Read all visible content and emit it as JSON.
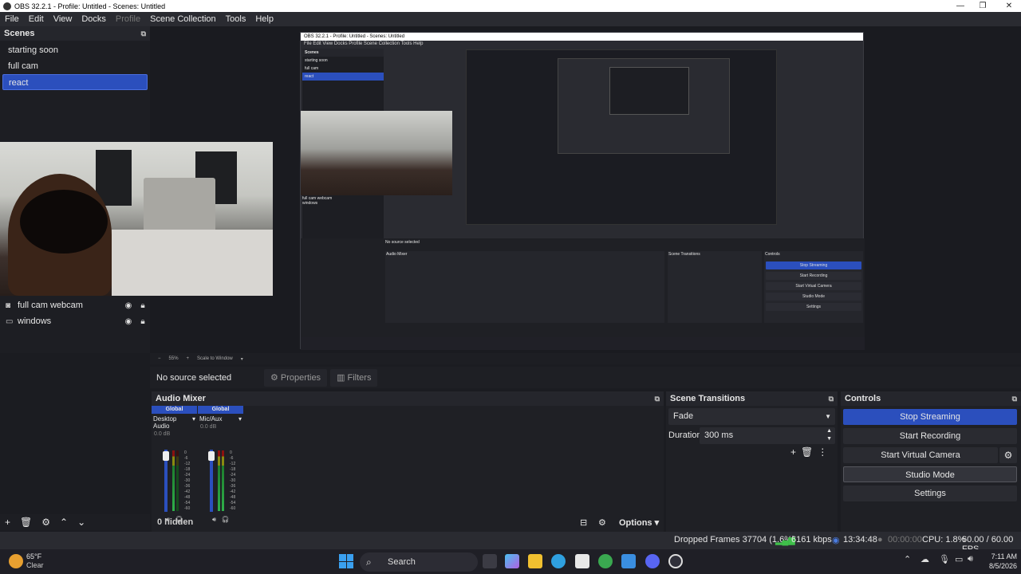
{
  "window": {
    "title": "OBS 32.2.1 - Profile: Untitled - Scenes: Untitled"
  },
  "menu": [
    "File",
    "Edit",
    "View",
    "Docks",
    "Profile",
    "Scene Collection",
    "Tools",
    "Help"
  ],
  "scenes": {
    "title": "Scenes",
    "items": [
      "starting soon",
      "full cam",
      "react"
    ],
    "active": "react"
  },
  "sources": {
    "items": [
      {
        "name": "full cam webcam",
        "icon": "camera-icon"
      },
      {
        "name": "windows",
        "icon": "monitor-icon"
      }
    ]
  },
  "preview": {
    "zoom": "55%",
    "scale_mode": "Scale to Window"
  },
  "context": {
    "no_source": "No source selected",
    "properties": "Properties",
    "filters": "Filters"
  },
  "audio_mixer": {
    "title": "Audio Mixer",
    "channels": [
      {
        "tag": "Global",
        "name": "Desktop Audio",
        "db": "0.0 dB"
      },
      {
        "tag": "Global",
        "name": "Mic/Aux",
        "db": "0.0 dB"
      }
    ],
    "scale": [
      "0",
      "-6",
      "-12",
      "-18",
      "-24",
      "-30",
      "-36",
      "-42",
      "-48",
      "-54",
      "-60"
    ],
    "hidden": "0 hidden",
    "options": "Options"
  },
  "transitions": {
    "title": "Scene Transitions",
    "selected": "Fade",
    "duration_label": "Duration",
    "duration": "300 ms"
  },
  "controls": {
    "title": "Controls",
    "stop_streaming": "Stop Streaming",
    "start_recording": "Start Recording",
    "start_virtual_camera": "Start Virtual Camera",
    "studio_mode": "Studio Mode",
    "settings": "Settings"
  },
  "status": {
    "dropped": "Dropped Frames 37704 (1.6%)",
    "bitrate": "6161 kbps",
    "stream_time": "13:34:48",
    "rec_time": "00:00:00",
    "cpu": "CPU: 1.8%",
    "fps": "60.00 / 60.00 FPS"
  },
  "taskbar": {
    "temp": "65°F",
    "condition": "Clear",
    "search": "Search",
    "time": "7:11 AM",
    "date": "8/5/2026"
  },
  "colors": {
    "accent": "#2b4fbd",
    "panel": "#1f2025",
    "bg": "#1b1c21"
  }
}
